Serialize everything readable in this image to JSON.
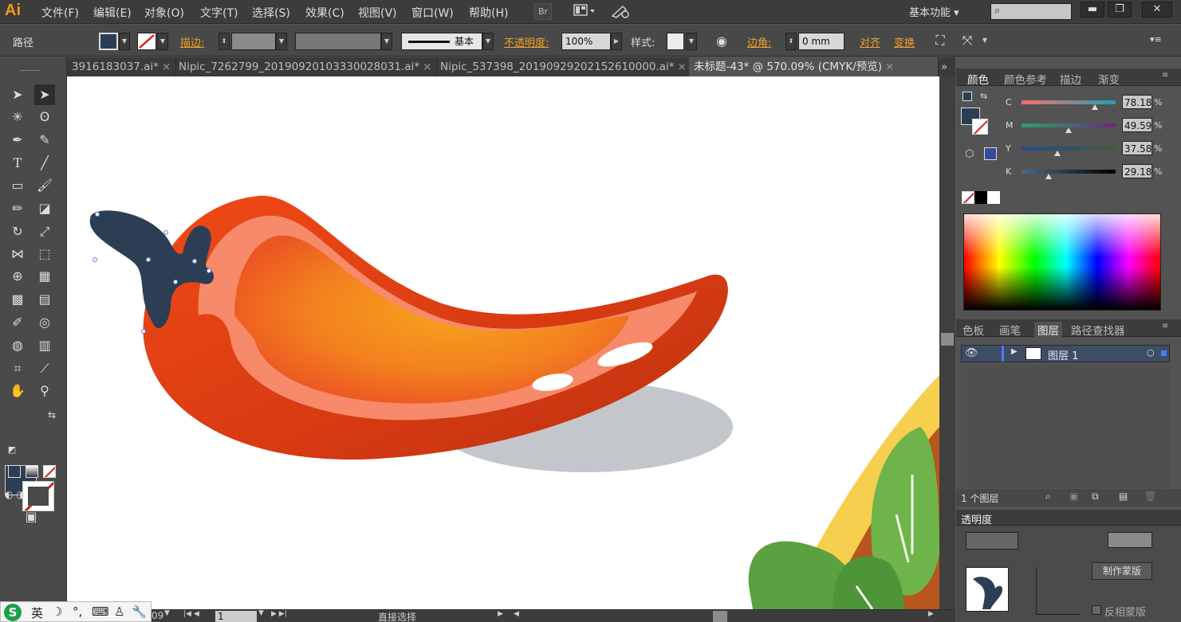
{
  "app": {
    "logo": "Ai"
  },
  "menu": [
    "文件(F)",
    "编辑(E)",
    "对象(O)",
    "文字(T)",
    "选择(S)",
    "效果(C)",
    "视图(V)",
    "窗口(W)",
    "帮助(H)"
  ],
  "menubar": {
    "bridge_label": "Br",
    "workspace": "基本功能",
    "workspace_arrow": "▾"
  },
  "control": {
    "selection_type": "路径",
    "stroke_label": "描边:",
    "stroke_style_label": "基本",
    "opacity_label": "不透明度:",
    "opacity_value": "100%",
    "style_label": "样式:",
    "corner_label": "边角:",
    "corner_value": "0 mm",
    "align_label": "对齐",
    "transform_label": "变换"
  },
  "tabs": [
    {
      "label": "3916183037.ai*",
      "close": "×"
    },
    {
      "label": "Nipic_7262799_20190920103330028031.ai*",
      "close": "×"
    },
    {
      "label": "Nipic_537398_20190929202152610000.ai*",
      "close": "×"
    },
    {
      "label": "未标题-43* @ 570.09% (CMYK/预览)",
      "close": "×"
    }
  ],
  "colors": {
    "fill": "#2b3e54",
    "accent": "#f0a028",
    "canvas": "#ffffff"
  },
  "color_panel": {
    "tabs": [
      "颜色",
      "颜色参考",
      "描边",
      "渐变"
    ],
    "sliders": [
      {
        "label": "C",
        "value": "78.18",
        "level": 0.78,
        "from": "#ff6b6b",
        "to": "#1ea0b4"
      },
      {
        "label": "M",
        "value": "49.59",
        "level": 0.5,
        "from": "#2aa36b",
        "to": "#6a2a7a"
      },
      {
        "label": "Y",
        "value": "37.58",
        "level": 0.38,
        "from": "#2b4a8a",
        "to": "#3c5c3a"
      },
      {
        "label": "K",
        "value": "29.18",
        "level": 0.29,
        "from": "#4a6a88",
        "to": "#000000"
      }
    ],
    "percent": "%"
  },
  "layers_panel": {
    "tabs": [
      "色板",
      "画笔",
      "图层",
      "路径查找器"
    ],
    "layer_name": "图层 1",
    "count": "1 个图层"
  },
  "transparency_panel": {
    "title": "透明度",
    "make_mask": "制作蒙版",
    "invert_mask": "反相蒙版"
  },
  "status": {
    "zoom_suffix": "09",
    "page": "1",
    "tool": "直接选择"
  },
  "ime": {
    "lang": "英"
  }
}
